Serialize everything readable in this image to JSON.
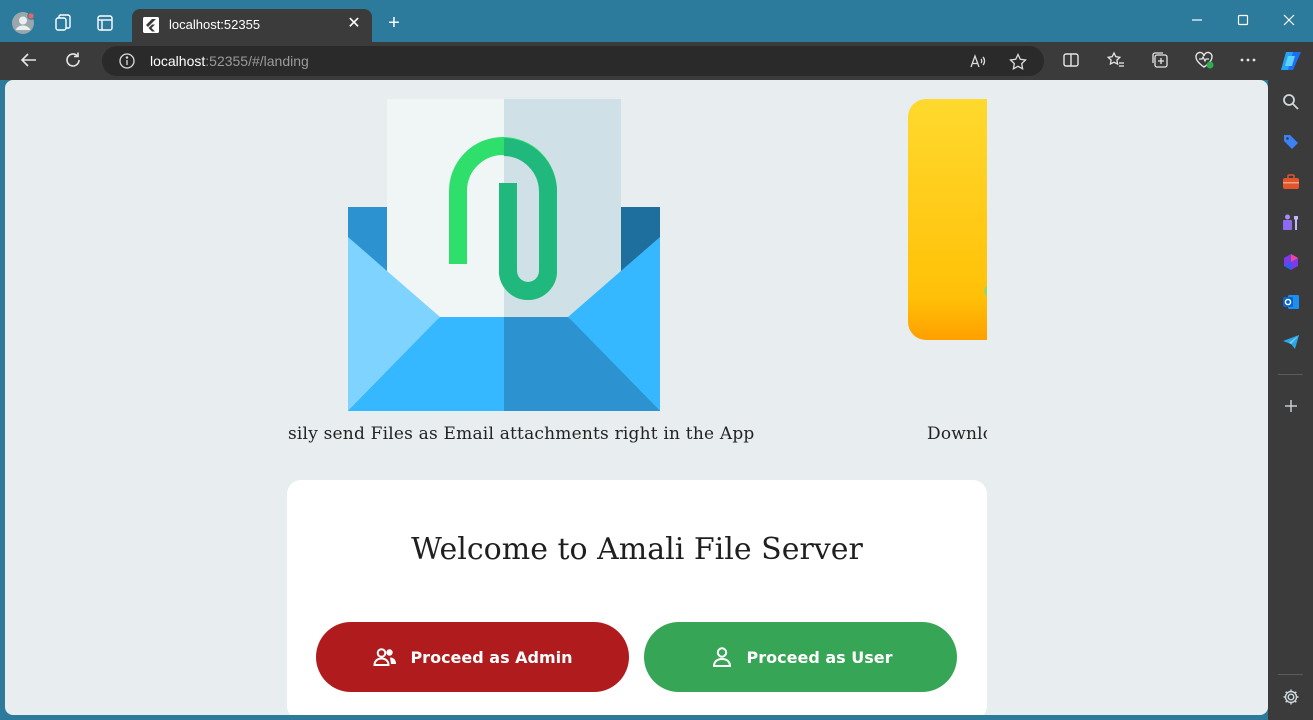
{
  "browser": {
    "tab_title": "localhost:52355",
    "new_tab_symbol": "+",
    "address_host": "localhost",
    "address_rest": ":52355/#/landing"
  },
  "carousel": {
    "slides": [
      {
        "caption": "sily send Files as Email attachments right in the App",
        "icon": "email-attachment-illustration"
      },
      {
        "caption": "Downlo",
        "icon": "yellow-folder-illustration"
      }
    ]
  },
  "welcome": {
    "title": "Welcome to Amali File Server",
    "admin_button": "Proceed as Admin",
    "user_button": "Proceed as User"
  },
  "colors": {
    "admin": "#b01c1e",
    "user": "#37a556",
    "browser_frame": "#2d7b9c"
  }
}
